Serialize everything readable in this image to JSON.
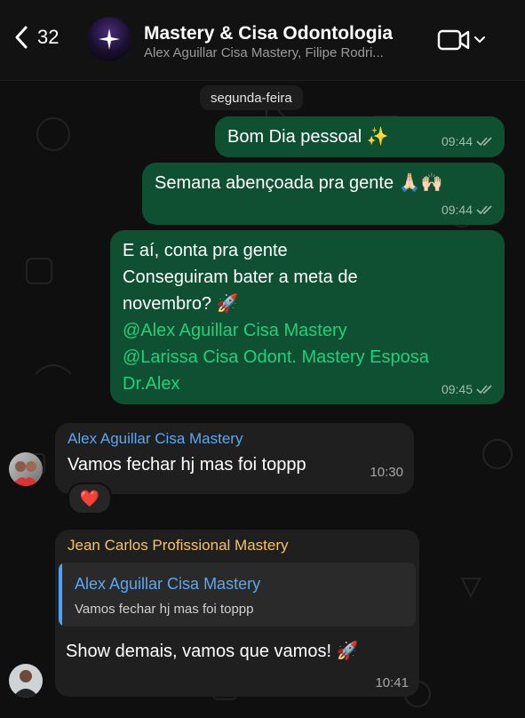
{
  "header": {
    "back_count": "32",
    "title": "Mastery & Cisa Odontologia",
    "subtitle": "Alex Aguillar Cisa Mastery, Filipe Rodri..."
  },
  "chat": {
    "date_separator": "segunda-feira",
    "messages": [
      {
        "type": "outgoing",
        "text": "Bom Dia pessoal ✨",
        "time": "09:44",
        "status": "read"
      },
      {
        "type": "outgoing",
        "text": "Semana abençoada pra gente 🙏🏻🙌🏻",
        "time": "09:44",
        "status": "read"
      },
      {
        "type": "outgoing",
        "line1": "E aí, conta pra gente",
        "line2": "Conseguiram bater a meta de",
        "line3": "novembro? 🚀",
        "mention1": "@Alex Aguillar Cisa Mastery",
        "mention2": "@Larissa Cisa Odont. Mastery Esposa",
        "mention2_cont": "Dr.Alex",
        "time": "09:45",
        "status": "read"
      },
      {
        "type": "incoming",
        "sender": "Alex Aguillar Cisa Mastery",
        "text": "Vamos fechar hj mas foi toppp",
        "time": "10:30",
        "reaction": "❤️"
      },
      {
        "type": "incoming",
        "sender": "Jean Carlos Profissional Mastery",
        "quote_sender": "Alex Aguillar Cisa Mastery",
        "quote_text": "Vamos fechar hj mas foi toppp",
        "text": "Show demais, vamos que vamos! 🚀",
        "time": "10:41"
      }
    ]
  },
  "colors": {
    "outgoing_bubble": "#0f5032",
    "incoming_bubble": "#1f1f1f",
    "mention": "#21d07a",
    "sender_alex": "#5aa8f0",
    "sender_jean": "#f2c46a",
    "quote_sender": "#5aa8f0"
  },
  "icons": [
    "chevron-left-icon",
    "sparkle-icon",
    "video-camera-icon",
    "chevron-down-icon",
    "double-check-icon"
  ]
}
